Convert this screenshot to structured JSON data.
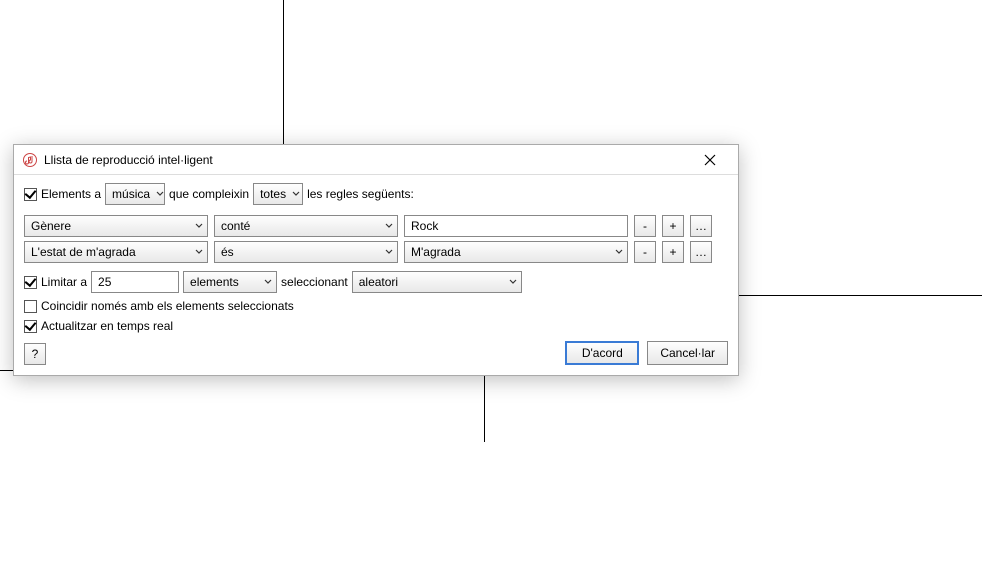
{
  "dialog": {
    "title": "Llista de reproducció intel·ligent",
    "icon_name": "music-note-icon"
  },
  "match_row": {
    "checkbox_checked": true,
    "prefix_label": "Elements a",
    "source_value": "música",
    "mid_label": "que compleixin",
    "match_value": "totes",
    "suffix_label": "les regles següents:"
  },
  "rules": [
    {
      "field": "Gènere",
      "operator": "conté",
      "value_type": "text",
      "value": "Rock"
    },
    {
      "field": "L'estat de m'agrada",
      "operator": "és",
      "value_type": "select",
      "value": "M'agrada"
    }
  ],
  "limit_row": {
    "checkbox_checked": true,
    "label": "Limitar a",
    "count": "25",
    "unit": "elements",
    "select_label": "seleccionant",
    "by": "aleatori"
  },
  "match_checked_row": {
    "checkbox_checked": false,
    "label": "Coincidir només amb els elements seleccionats"
  },
  "live_update_row": {
    "checkbox_checked": true,
    "label": "Actualitzar en temps real"
  },
  "buttons": {
    "help": "?",
    "ok": "D'acord",
    "cancel": "Cancel·lar",
    "remove": "-",
    "add": "+",
    "nest": "…"
  }
}
